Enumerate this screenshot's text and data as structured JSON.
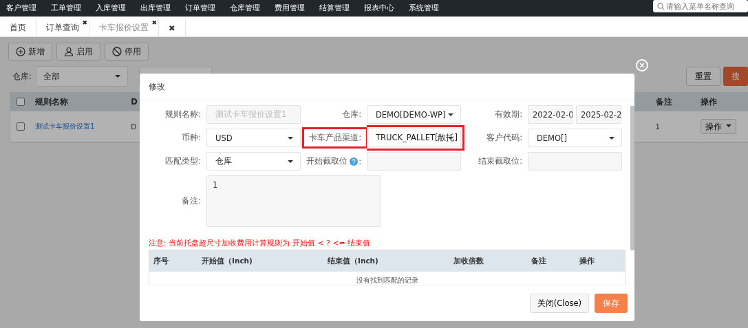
{
  "top_menu": [
    {
      "label": "客户管理"
    },
    {
      "label": "工单管理"
    },
    {
      "label": "入库管理"
    },
    {
      "label": "出库管理"
    },
    {
      "label": "订单管理"
    },
    {
      "label": "仓库管理"
    },
    {
      "label": "费用管理"
    },
    {
      "label": "结算管理"
    },
    {
      "label": "报表中心"
    },
    {
      "label": "系统管理"
    }
  ],
  "menu_search": {
    "placeholder": "请输入菜单名称查询"
  },
  "tabs": [
    {
      "label": "首页",
      "selected": false
    },
    {
      "label": "订单查询",
      "close": "✖",
      "selected": false
    },
    {
      "label": "卡车报价设置",
      "close": "✖",
      "selected": true
    }
  ],
  "tabs_close_all": "✖",
  "toolbar": [
    {
      "label": "新增"
    },
    {
      "label": "启用"
    },
    {
      "label": "停用"
    }
  ],
  "filters": {
    "warehouse_label": "仓库:",
    "warehouse_value": "全部",
    "reset": "重置",
    "search": "搜"
  },
  "table": {
    "columns": [
      "规则名称",
      "D",
      "备注",
      "操作"
    ],
    "rows": [
      {
        "name": "测试卡车报价设置1",
        "col2": "D",
        "remark": "1",
        "action": "操作",
        "checked": false
      }
    ],
    "header_checked": false
  },
  "modal": {
    "title": "修改",
    "fields": [
      {
        "label": "规则名称:",
        "kind": "text",
        "value": "测试卡车报价设置1",
        "disabled": true
      },
      {
        "label": "仓库:",
        "kind": "select",
        "value": "DEMO[DEMO-WP]"
      },
      {
        "label": "有效期:",
        "kind": "daterange",
        "value": "2022-02-0",
        "value2": "2025-02-2"
      },
      {
        "label": "币种:",
        "kind": "select",
        "value": "USD"
      },
      {
        "label": "卡车产品渠道:",
        "kind": "select",
        "value": "TRUCK_PALLET[散托]",
        "highlighted": true
      },
      {
        "label": "客户代码:",
        "kind": "select",
        "value": "DEMO[]"
      },
      {
        "label": "匹配类型:",
        "kind": "select",
        "value": "仓库"
      },
      {
        "label": "开始截取位",
        "kind": "text",
        "help": true,
        "colon": ":"
      },
      {
        "label": "结束截取位:",
        "kind": "text"
      }
    ],
    "remark_label": "备注:",
    "remark_value": "1",
    "note": "注意:  当前托盘超尺寸加收费用计算规则为 开始值 < ? <= 结束值",
    "columns": [
      "序号",
      "开始值（Inch)",
      "结束值（Inch)",
      "加收倍数",
      "备注",
      "操作"
    ],
    "empty": "没有找到匹配的记录",
    "close_button": "关闭(Close)",
    "save_button": "保存"
  }
}
